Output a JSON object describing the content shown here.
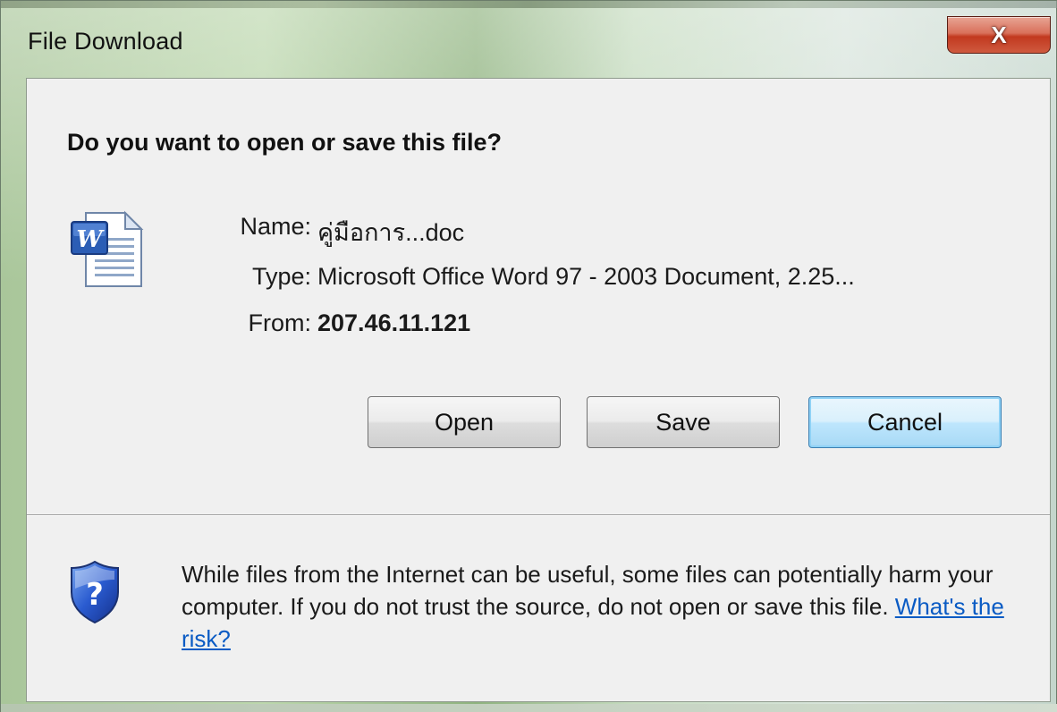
{
  "window": {
    "title": "File Download",
    "close_label": "X"
  },
  "dialog": {
    "question": "Do you want to open or save this file?",
    "file_icon": "word-document-icon",
    "name_label": "Name:",
    "name_value": "คู่มือการ...doc",
    "type_label": "Type:",
    "type_value": "Microsoft Office Word 97 - 2003 Document, 2.25...",
    "from_label": "From:",
    "from_value": "207.46.11.121"
  },
  "buttons": {
    "open": "Open",
    "save": "Save",
    "cancel": "Cancel"
  },
  "warning": {
    "icon": "security-shield-question-icon",
    "text": "While files from the Internet can be useful, some files can potentially harm your computer. If you do not trust the source, do not open or save this file.",
    "link": "What's the risk?"
  },
  "colors": {
    "link": "#0a5bc4",
    "close_button": "#c2391f",
    "default_button_border": "#3c7fb1"
  }
}
